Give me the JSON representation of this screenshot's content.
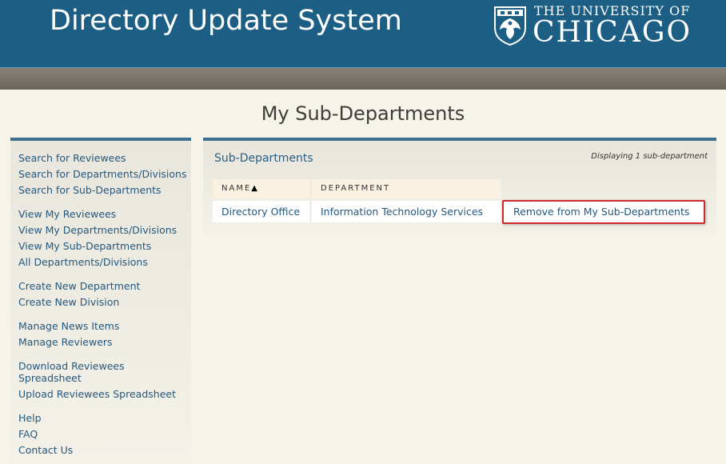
{
  "header": {
    "app_title": "Directory Update System",
    "university_line1": "THE UNIVERSITY OF",
    "university_line2": "CHICAGO",
    "logo_icon": "phoenix-shield-icon",
    "colors": {
      "header_bg": "#1c5e84",
      "link": "#25587d",
      "accent_border": "#cc2b2b"
    }
  },
  "page": {
    "title": "My Sub-Departments"
  },
  "sidebar": {
    "items": [
      {
        "label": "Search for Reviewees"
      },
      {
        "label": "Search for Departments/Divisions"
      },
      {
        "label": "Search for Sub-Departments"
      },
      {
        "label": "View My Reviewees"
      },
      {
        "label": "View My Departments/Divisions"
      },
      {
        "label": "View My Sub-Departments"
      },
      {
        "label": "All Departments/Divisions"
      },
      {
        "label": "Create New Department"
      },
      {
        "label": "Create New Division"
      },
      {
        "label": "Manage News Items"
      },
      {
        "label": "Manage Reviewers"
      },
      {
        "label": "Download Reviewees\nSpreadsheet"
      },
      {
        "label": "Upload Reviewees Spreadsheet"
      },
      {
        "label": "Help"
      },
      {
        "label": "FAQ"
      },
      {
        "label": "Contact Us"
      }
    ]
  },
  "panel": {
    "title": "Sub-Departments",
    "count_text": "Displaying 1 sub-department",
    "columns": [
      {
        "label": "NAME",
        "sort_indicator": "▲"
      },
      {
        "label": "DEPARTMENT"
      }
    ],
    "rows": [
      {
        "name": "Directory Office",
        "department": "Information Technology Services",
        "action": "Remove from My Sub-Departments"
      }
    ]
  }
}
